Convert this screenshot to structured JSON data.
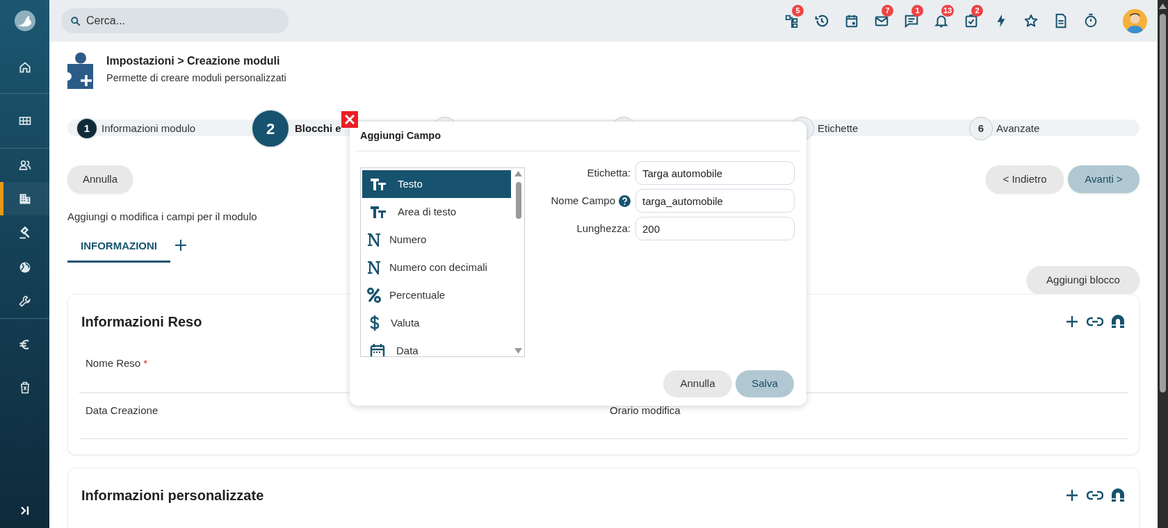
{
  "search": {
    "placeholder": "Cerca..."
  },
  "toolbar": [
    {
      "notified": true,
      "badge": "5"
    },
    {
      "notified": false
    },
    {
      "notified": false
    },
    {
      "notified": true,
      "badge": "7"
    },
    {
      "notified": true,
      "badge": "1"
    },
    {
      "notified": true,
      "badge": "13"
    },
    {
      "notified": true,
      "badge": "2"
    },
    {
      "notified": false
    },
    {
      "notified": false
    },
    {
      "notified": false
    },
    {
      "notified": false
    }
  ],
  "sidebar": {
    "items": [
      {
        "selected": false
      },
      {
        "selected": false
      },
      {
        "selected": false
      },
      {
        "selected": true
      },
      {
        "selected": false
      },
      {
        "selected": false
      },
      {
        "selected": false
      },
      {
        "selected": false
      },
      {
        "selected": false
      }
    ]
  },
  "header": {
    "title": "Impostazioni > Creazione moduli",
    "subtitle": "Permette di creare moduli personalizzati"
  },
  "steps": [
    {
      "completed": true,
      "selected": false,
      "number": "1",
      "label": "Informazioni modulo"
    },
    {
      "completed": false,
      "selected": true,
      "number": "2",
      "label": "Blocchi e"
    },
    {
      "completed": false,
      "selected": false
    },
    {
      "completed": false,
      "selected": false
    },
    {
      "completed": false,
      "selected": false,
      "label": "Etichette"
    },
    {
      "completed": false,
      "selected": false,
      "number": "6",
      "label": "Avanzate"
    }
  ],
  "actions": {
    "cancel": "Annulla",
    "back": "< Indietro",
    "next": "Avanti >"
  },
  "intro": "Aggiungi o modifica i campi per il modulo",
  "tabs": [
    {
      "label": "INFORMAZIONI",
      "selected": true
    }
  ],
  "add_block": "Aggiungi blocco",
  "blocks": [
    {
      "title": "Informazioni Reso",
      "rows": [
        [
          {
            "label": "Nome Reso",
            "mark": "*"
          }
        ],
        [
          {
            "label": "Data Creazione"
          },
          {
            "label": "Orario modifica"
          }
        ]
      ]
    },
    {
      "title": "Informazioni personalizzate"
    }
  ],
  "dialog": {
    "title": "Aggiungi Campo",
    "types": [
      {
        "label": "Testo",
        "selected": true
      },
      {
        "label": "Area di testo",
        "selected": false
      },
      {
        "label": "Numero",
        "selected": false
      },
      {
        "label": "Numero con decimali",
        "selected": false
      },
      {
        "label": "Percentuale",
        "selected": false
      },
      {
        "label": "Valuta",
        "selected": false
      },
      {
        "label": "Data",
        "selected": false
      }
    ],
    "fields": [
      {
        "label": "Etichetta:",
        "value": "Targa automobile",
        "help": false
      },
      {
        "label": "Nome Campo",
        "value": "targa_automobile",
        "help": true
      },
      {
        "label": "Lunghezza:",
        "value": "200",
        "help": false
      }
    ],
    "buttons": {
      "cancel": "Annulla",
      "save": "Salva"
    }
  }
}
